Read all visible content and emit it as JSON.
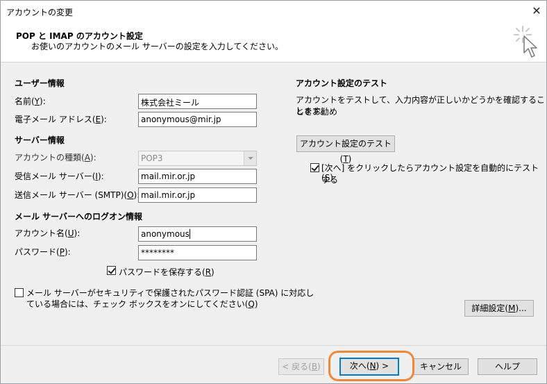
{
  "window": {
    "title": "アカウントの変更",
    "close_icon": "close-icon"
  },
  "header": {
    "title": "POP と IMAP のアカウント設定",
    "subtitle": "お使いのアカウントのメール サーバーの設定を入力してください。",
    "icon": "cursor-click-icon"
  },
  "user_info": {
    "heading": "ユーザー情報",
    "name_label": "名前(",
    "name_key": "Y",
    "name_value": "株式会社ミール",
    "email_label": "電子メール アドレス(",
    "email_key": "E",
    "email_value": "anonymous@mir.jp"
  },
  "server_info": {
    "heading": "サーバー情報",
    "account_type_label": "アカウントの種類(",
    "account_type_key": "A",
    "account_type_value": "POP3",
    "incoming_label": "受信メール サーバー(",
    "incoming_key": "I",
    "incoming_value": "mail.mir.or.jp",
    "outgoing_label": "送信メール サーバー (SMTP)(",
    "outgoing_key": "O",
    "outgoing_value": "mail.mir.or.jp"
  },
  "logon_info": {
    "heading": "メール サーバーへのログオン情報",
    "account_name_label": "アカウント名(",
    "account_name_key": "U",
    "account_name_value": "anonymous",
    "password_label": "パスワード(",
    "password_key": "P",
    "password_value": "********",
    "save_password_label": "パスワードを保存する(",
    "save_password_key": "R",
    "save_password_checked": true,
    "spa_line1": "メール サーバーがセキュリティで保護されたパスワード認証 (SPA) に対応し",
    "spa_line2": "ている場合には、チェック ボックスをオンにしてください(",
    "spa_key": "Q",
    "spa_checked": false
  },
  "test": {
    "heading": "アカウント設定のテスト",
    "description_line1": "アカウントをテストして、入力内容が正しいかどうかを確認することをお勧め",
    "description_line2": "します。",
    "test_button_label": "アカウント設定のテスト(",
    "test_button_key": "T",
    "auto_test_label": "[次へ] をクリックしたらアカウント設定を自動的にテストする",
    "auto_test_key": "S",
    "auto_test_checked": true,
    "advanced_button_label": "詳細設定(",
    "advanced_button_key": "M",
    "advanced_button_suffix": ")..."
  },
  "footer": {
    "back_label": "< 戻る(",
    "back_key": "B",
    "next_label": "次へ(",
    "next_key": "N",
    "next_suffix": ") >",
    "cancel_label": "キャンセル",
    "help_label": "ヘルプ",
    "highlight_color": "#f0883a"
  },
  "close_paren": ")",
  "colon_paren": "):"
}
